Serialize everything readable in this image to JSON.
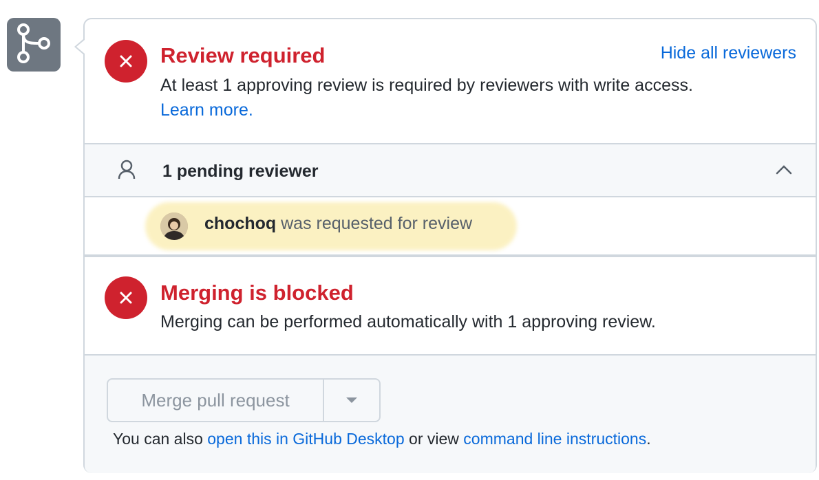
{
  "merge_badge_icon": "git-branch-icon",
  "review": {
    "title": "Review required",
    "description": "At least 1 approving review is required by reviewers with write access.",
    "learn_more": "Learn more.",
    "hide_reviewers": "Hide all reviewers"
  },
  "pending": {
    "label": "1 pending reviewer",
    "reviewer_name": "chochoq",
    "reviewer_status": " was requested for review"
  },
  "blocked": {
    "title": "Merging is blocked",
    "description": "Merging can be performed automatically with 1 approving review."
  },
  "merge": {
    "button_label": "Merge pull request",
    "also_prefix": "You can also ",
    "desktop_link": "open this in GitHub Desktop",
    "middle": " or view ",
    "cli_link": "command line instructions",
    "suffix": "."
  },
  "colors": {
    "error": "#cf222e",
    "link": "#0969da",
    "highlight": "#fbefb8",
    "badge": "#6e7781"
  }
}
